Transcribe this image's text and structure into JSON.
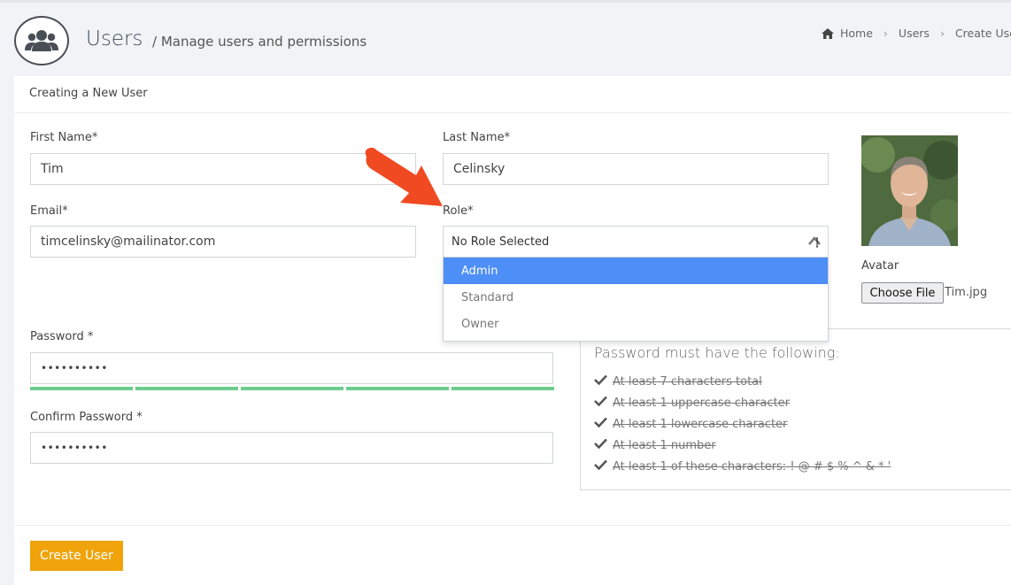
{
  "header": {
    "title": "Users",
    "subtitle": "/ Manage users and permissions",
    "breadcrumb": [
      "Home",
      "Users",
      "Create User"
    ]
  },
  "card": {
    "title": "Creating a New User"
  },
  "form": {
    "first_name": {
      "label": "First Name*",
      "value": "Tim"
    },
    "last_name": {
      "label": "Last Name*",
      "value": "Celinsky"
    },
    "email": {
      "label": "Email*",
      "value": "timcelinsky@mailinator.com"
    },
    "role": {
      "label": "Role*",
      "selected": "No Role Selected",
      "options": [
        "Admin",
        "Standard",
        "Owner"
      ],
      "highlighted": "Admin"
    },
    "password": {
      "label": "Password *",
      "value": "••••••••••",
      "strength_segments_filled": 5,
      "strength_segments_total": 5
    },
    "confirm_password": {
      "label": "Confirm Password *",
      "value": "••••••••••"
    },
    "avatar": {
      "label": "Avatar",
      "button": "Choose File",
      "file_name": "Tim.jpg"
    }
  },
  "password_rules": {
    "title": "Password must have the following:",
    "items": [
      "At least 7 characters total",
      "At least 1 uppercase character",
      "At least 1 lowercase character",
      "At least 1 number",
      "At least 1 of these characters: ! @ # $ % ^ & * '"
    ]
  },
  "actions": {
    "submit": "Create User"
  },
  "colors": {
    "accent": "#f0a30a",
    "highlight": "#4d8ef7",
    "strength": "#6dcc8e",
    "arrow": "#f04a23"
  }
}
